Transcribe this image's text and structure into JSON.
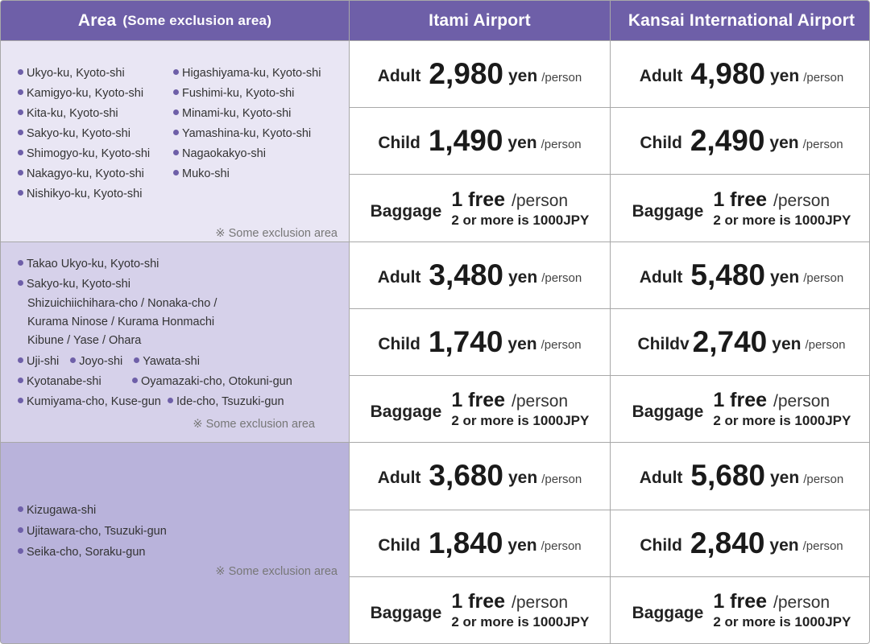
{
  "header": {
    "area": "Area",
    "area_note": "(Some exclusion area)",
    "itami": "Itami Airport",
    "kansai": "Kansai International Airport"
  },
  "note": "※ Some exclusion area",
  "region1": {
    "left": [
      "Ukyo-ku, Kyoto-shi",
      "Kamigyo-ku, Kyoto-shi",
      "Kita-ku, Kyoto-shi",
      "Sakyo-ku, Kyoto-shi",
      "Shimogyo-ku, Kyoto-shi",
      "Nakagyo-ku, Kyoto-shi",
      "Nishikyo-ku, Kyoto-shi"
    ],
    "right": [
      "Higashiyama-ku, Kyoto-shi",
      "Fushimi-ku, Kyoto-shi",
      "Minami-ku, Kyoto-shi",
      "Yamashina-ku, Kyoto-shi",
      "Nagaokakyo-shi",
      "Muko-shi"
    ]
  },
  "region2": {
    "l1": "Takao Ukyo-ku, Kyoto-shi",
    "l2": "Sakyo-ku, Kyoto-shi",
    "l3": "Shizuichiichihara-cho / Nonaka-cho /",
    "l4": "Kurama Ninose / Kurama Honmachi",
    "l5": "Kibune / Yase / Ohara",
    "l6a": "Uji-shi",
    "l6b": "Joyo-shi",
    "l6c": "Yawata-shi",
    "l7a": "Kyotanabe-shi",
    "l7b": "Oyamazaki-cho, Otokuni-gun",
    "l8a": "Kumiyama-cho, Kuse-gun",
    "l8b": "Ide-cho, Tsuzuki-gun"
  },
  "region3": {
    "items": [
      "Kizugawa-shi",
      "Ujitawara-cho, Tsuzuki-gun",
      "Seika-cho, Soraku-gun"
    ]
  },
  "prices": {
    "r1": {
      "itami": {
        "adult": "2,980",
        "child": "1,490"
      },
      "kansai": {
        "adult": "4,980",
        "child": "2,490"
      }
    },
    "r2": {
      "itami": {
        "adult": "3,480",
        "child": "1,740"
      },
      "kansai": {
        "adult": "5,480",
        "child": "2,740",
        "child_label": "Childv"
      }
    },
    "r3": {
      "itami": {
        "adult": "3,680",
        "child": "1,840"
      },
      "kansai": {
        "adult": "5,680",
        "child": "2,840"
      }
    }
  },
  "labels": {
    "adult": "Adult",
    "child": "Child",
    "baggage": "Baggage",
    "yen": "yen",
    "per_person": "/person",
    "free": "1 free",
    "bag_per": "/person",
    "bag_note": "2 or more is 1000JPY"
  }
}
